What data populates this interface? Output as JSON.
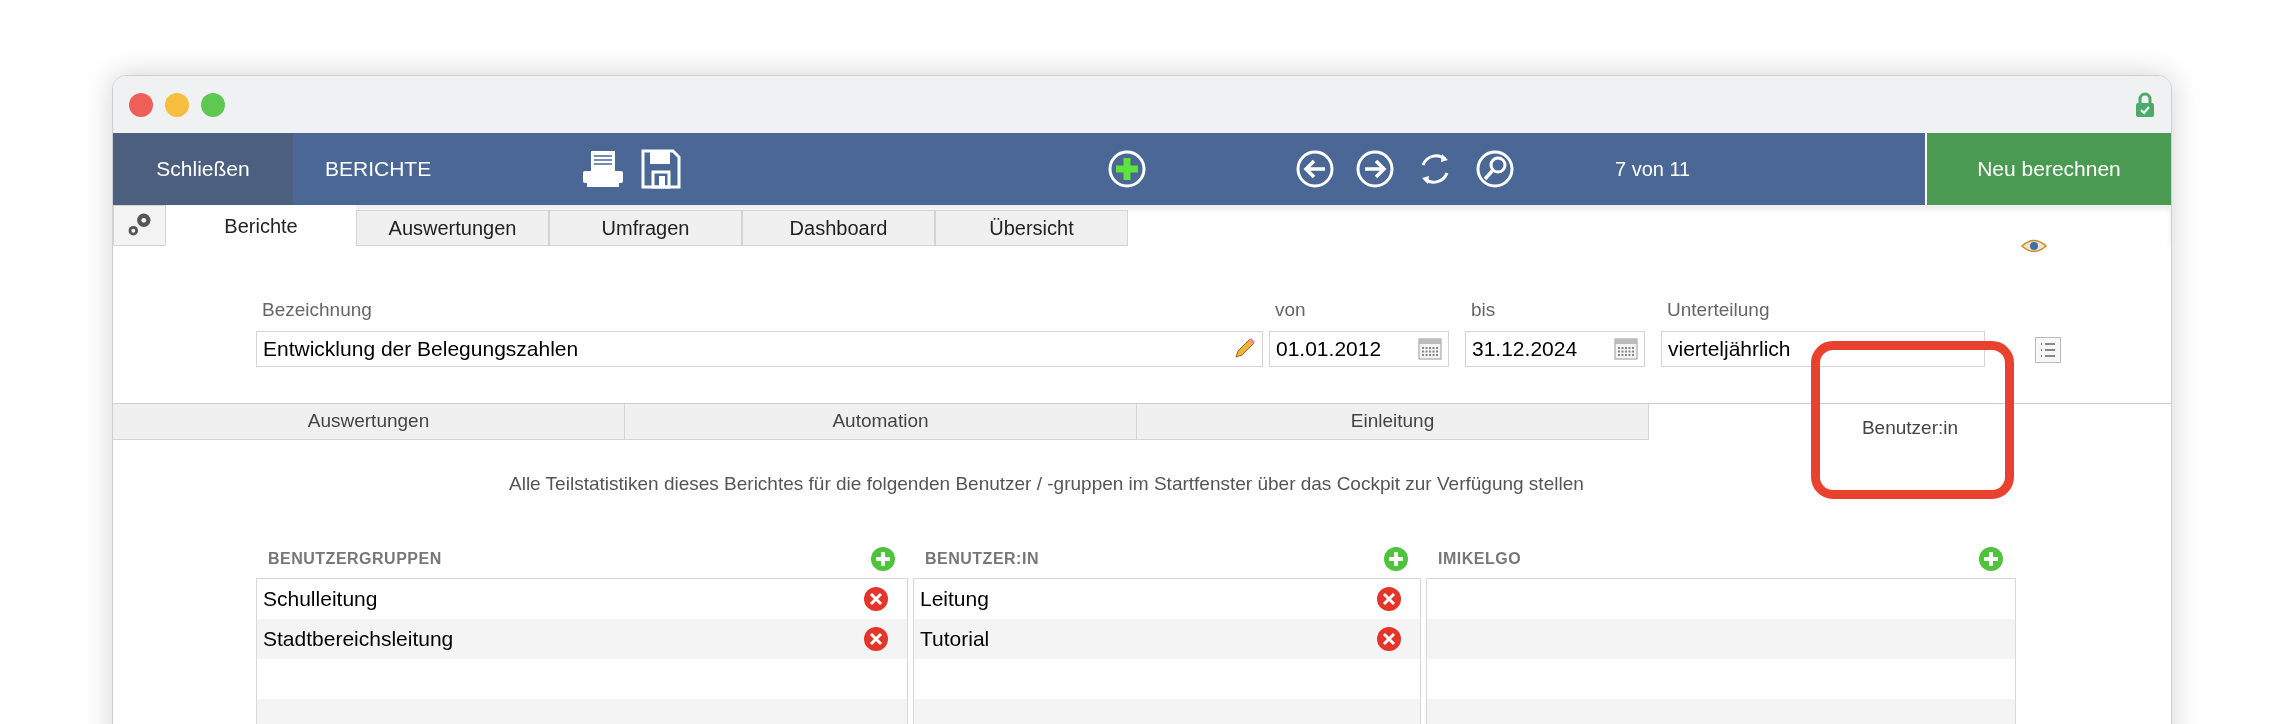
{
  "toolbar": {
    "close": "Schließen",
    "title": "BERICHTE",
    "counter": "7 von 11",
    "recalc": "Neu berechnen"
  },
  "tabs": [
    {
      "label": "Berichte",
      "selected": true
    },
    {
      "label": "Auswertungen",
      "selected": false
    },
    {
      "label": "Umfragen",
      "selected": false
    },
    {
      "label": "Dashboard",
      "selected": false
    },
    {
      "label": "Übersicht",
      "selected": false
    }
  ],
  "fields": {
    "name": {
      "label": "Bezeichnung",
      "value": "Entwicklung der Belegungszahlen"
    },
    "from": {
      "label": "von",
      "value": "01.01.2012"
    },
    "to": {
      "label": "bis",
      "value": "31.12.2024"
    },
    "division": {
      "label": "Unterteilung",
      "value": "vierteljährlich"
    }
  },
  "section_tabs": [
    {
      "label": "Auswertungen",
      "selected": false
    },
    {
      "label": "Automation",
      "selected": false
    },
    {
      "label": "Einleitung",
      "selected": false
    },
    {
      "label": "Benutzer:in",
      "selected": true
    }
  ],
  "description": "Alle Teilstatistiken dieses Berichtes für die folgenden Benutzer / -gruppen im Startfenster über das Cockpit zur Verfügung stellen",
  "lists": [
    {
      "title": "BENUTZERGRUPPEN",
      "items": [
        "Schulleitung",
        "Stadtbereichsleitung"
      ]
    },
    {
      "title": "BENUTZER:IN",
      "items": [
        "Leitung",
        "Tutorial"
      ]
    },
    {
      "title": "IMIKELGO"
    }
  ]
}
